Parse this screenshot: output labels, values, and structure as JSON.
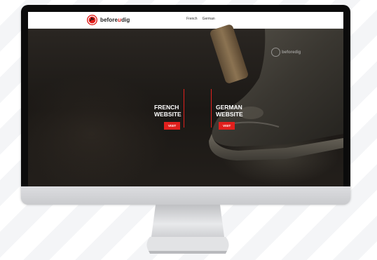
{
  "header": {
    "logo_text_before": "before",
    "logo_text_u": "u",
    "logo_text_dig": "dig",
    "nav": [
      "French",
      "German"
    ]
  },
  "hero": {
    "watermark_before": "before",
    "watermark_dig": "dig",
    "panels": [
      {
        "title_line1": "FRENCH",
        "title_line2": "WEBSITE",
        "button": "VISIT"
      },
      {
        "title_line1": "GERMAN",
        "title_line2": "WEBSITE",
        "button": "VISIT"
      }
    ]
  },
  "colors": {
    "accent": "#e1201d",
    "bezel": "#0b0b0b",
    "chin": "#d2d3d6"
  }
}
